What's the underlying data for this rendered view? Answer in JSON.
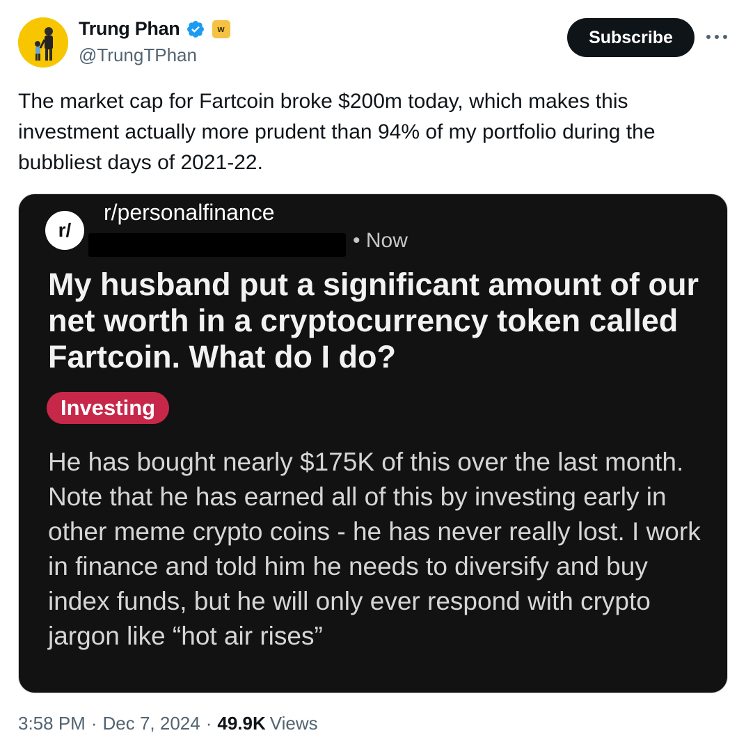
{
  "author": {
    "display_name": "Trung Phan",
    "handle": "@TrungTPhan",
    "verified_icon": "verified-badge-icon",
    "affiliate_badge": "w"
  },
  "actions": {
    "subscribe_label": "Subscribe",
    "more_icon": "more-options-icon"
  },
  "tweet": {
    "text": "The market cap for Fartcoin broke $200m today, which makes this\ninvestment actually more prudent than 94% of my portfolio during the\nbubbliest days of 2021-22."
  },
  "embedded_post": {
    "subreddit_icon": "r/",
    "subreddit": "r/personalfinance",
    "time": "• Now",
    "title": "My husband put a significant amount of our net worth in a cryptocurrency token called Fartcoin. What do I do?",
    "flair": "Investing",
    "body": "He has bought nearly $175K of this over the last month. Note that he has earned all of this by investing early in other meme crypto coins - he has never really lost. I work in finance and told him he needs to diversify and buy index funds, but he will only ever respond with crypto jargon like “hot air rises”"
  },
  "footer": {
    "time": "3:58 PM",
    "date": "Dec 7, 2024",
    "views_count": "49.9K",
    "views_label": "Views"
  },
  "colors": {
    "accent": "#1d9bf0",
    "flair": "#c7284a",
    "card_bg": "#121212"
  }
}
